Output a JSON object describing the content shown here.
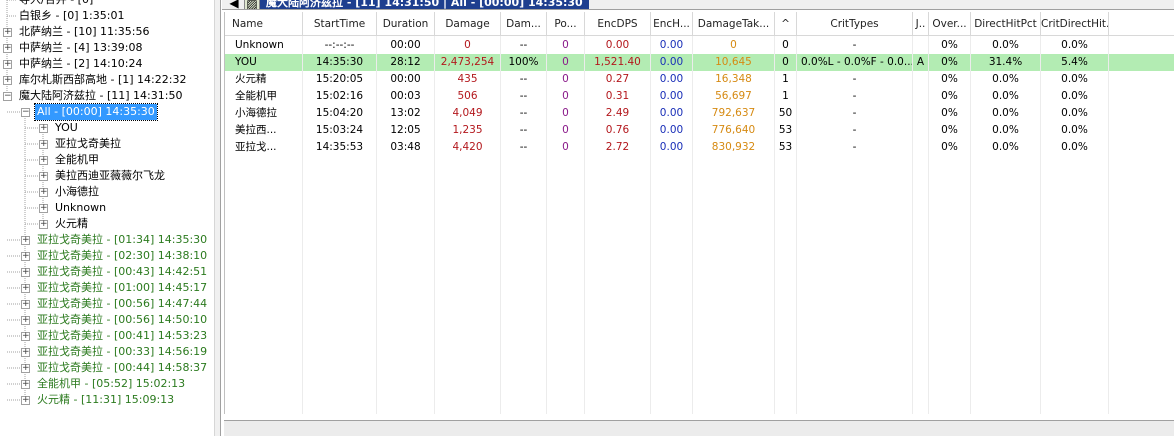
{
  "tree": {
    "items": [
      {
        "label": "导入/合并 - [0]",
        "exp": "none",
        "color": "black"
      },
      {
        "label": "白银乡 - [0] 1:35:01",
        "exp": "none",
        "color": "black"
      },
      {
        "label": "北萨纳兰 - [10] 11:35:56",
        "exp": "+",
        "color": "black"
      },
      {
        "label": "中萨纳兰 - [4] 13:39:08",
        "exp": "+",
        "color": "black"
      },
      {
        "label": "中萨纳兰 - [2] 14:10:24",
        "exp": "+",
        "color": "black"
      },
      {
        "label": "库尔札斯西部高地 - [1] 14:22:32",
        "exp": "+",
        "color": "black"
      },
      {
        "label": "魔大陆阿济兹拉 - [11] 14:31:50",
        "exp": "-",
        "color": "black"
      },
      {
        "label": "All - [00:00] 14:35:30",
        "exp": "-",
        "color": "selected"
      },
      {
        "label": "YOU",
        "exp": "+",
        "color": "black"
      },
      {
        "label": "亚拉戈奇美拉",
        "exp": "+",
        "color": "black"
      },
      {
        "label": "全能机甲",
        "exp": "+",
        "color": "black"
      },
      {
        "label": "美拉西迪亚薇薇尔飞龙",
        "exp": "+",
        "color": "black"
      },
      {
        "label": "小海德拉",
        "exp": "+",
        "color": "black"
      },
      {
        "label": "Unknown",
        "exp": "+",
        "color": "black"
      },
      {
        "label": "火元精",
        "exp": "+",
        "color": "black"
      },
      {
        "label": "亚拉戈奇美拉 - [01:34] 14:35:30",
        "exp": "+",
        "color": "green"
      },
      {
        "label": "亚拉戈奇美拉 - [02:30] 14:38:10",
        "exp": "+",
        "color": "green"
      },
      {
        "label": "亚拉戈奇美拉 - [00:43] 14:42:51",
        "exp": "+",
        "color": "green"
      },
      {
        "label": "亚拉戈奇美拉 - [01:00] 14:45:17",
        "exp": "+",
        "color": "green"
      },
      {
        "label": "亚拉戈奇美拉 - [00:56] 14:47:44",
        "exp": "+",
        "color": "green"
      },
      {
        "label": "亚拉戈奇美拉 - [00:56] 14:50:10",
        "exp": "+",
        "color": "green"
      },
      {
        "label": "亚拉戈奇美拉 - [00:41] 14:53:23",
        "exp": "+",
        "color": "green"
      },
      {
        "label": "亚拉戈奇美拉 - [00:33] 14:56:19",
        "exp": "+",
        "color": "green"
      },
      {
        "label": "亚拉戈奇美拉 - [00:44] 14:58:37",
        "exp": "+",
        "color": "green"
      },
      {
        "label": "全能机甲 - [05:52] 15:02:13",
        "exp": "+",
        "color": "green"
      },
      {
        "label": "火元精 - [11:31] 15:09:13",
        "exp": "+",
        "color": "green"
      }
    ]
  },
  "toolbar": {
    "back_icon": "back-arrow-icon",
    "image_icon": "picture-icon",
    "title": "魔大陆阿济兹拉 - [11] 14:31:50 | All - [00:00] 14:35:30"
  },
  "grid": {
    "columns": [
      "Name",
      "StartTime",
      "Duration",
      "Damage",
      "Dam...",
      "Po...",
      "EncDPS",
      "EncH...",
      "DamageTak...",
      "^",
      "CritTypes",
      "J..",
      "Over...",
      "DirectHitPct",
      "CritDirectHit..."
    ],
    "rows": [
      {
        "cells": [
          "Unknown",
          "--:--:--",
          "00:00",
          "0",
          "--",
          "0",
          "0.00",
          "0.00",
          "0",
          "0",
          "-",
          "",
          "0%",
          "0.0%",
          "0.0%"
        ],
        "highlight": false
      },
      {
        "cells": [
          "YOU",
          "14:35:30",
          "28:12",
          "2,473,254",
          "100%",
          "0",
          "1,521.40",
          "0.00",
          "10,645",
          "0",
          "0.0%L - 0.0%F - 0.0...",
          "A",
          "0%",
          "31.4%",
          "5.4%"
        ],
        "highlight": true
      },
      {
        "cells": [
          "火元精",
          "15:20:05",
          "00:00",
          "435",
          "--",
          "0",
          "0.27",
          "0.00",
          "16,348",
          "1",
          "-",
          "",
          "0%",
          "0.0%",
          "0.0%"
        ],
        "highlight": false
      },
      {
        "cells": [
          "全能机甲",
          "15:02:16",
          "00:03",
          "506",
          "--",
          "0",
          "0.31",
          "0.00",
          "56,697",
          "1",
          "-",
          "",
          "0%",
          "0.0%",
          "0.0%"
        ],
        "highlight": false
      },
      {
        "cells": [
          "小海德拉",
          "15:04:20",
          "13:02",
          "4,049",
          "--",
          "0",
          "2.49",
          "0.00",
          "792,637",
          "50",
          "-",
          "",
          "0%",
          "0.0%",
          "0.0%"
        ],
        "highlight": false
      },
      {
        "cells": [
          "美拉西...",
          "15:03:24",
          "12:05",
          "1,235",
          "--",
          "0",
          "0.76",
          "0.00",
          "776,640",
          "53",
          "-",
          "",
          "0%",
          "0.0%",
          "0.0%"
        ],
        "highlight": false
      },
      {
        "cells": [
          "亚拉戈...",
          "14:35:53",
          "03:48",
          "4,420",
          "--",
          "0",
          "2.72",
          "0.00",
          "830,932",
          "53",
          "-",
          "",
          "0%",
          "0.0%",
          "0.0%"
        ],
        "highlight": false
      }
    ]
  },
  "colors": {
    "selected_bg": "#3399ff",
    "encounter_green": "#2b7a1e",
    "row_highlight": "#b3ecb3",
    "damage_red": "#b3171c",
    "damage_taken_orange": "#d68a12",
    "title_blue": "#1e3f8f"
  }
}
